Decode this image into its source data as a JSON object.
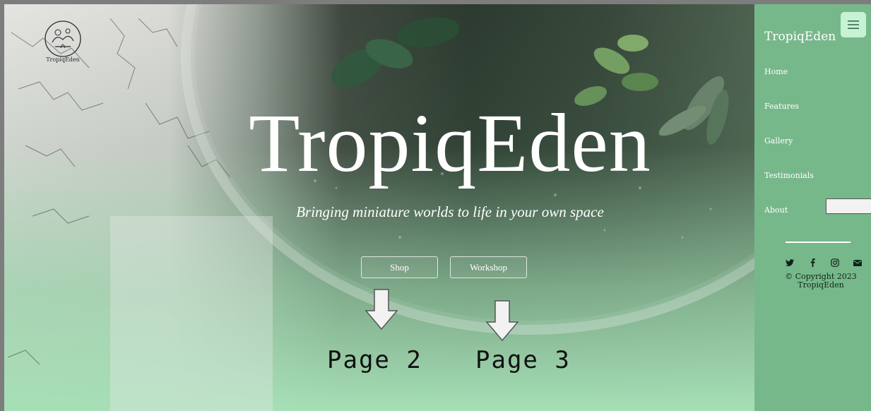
{
  "logo": {
    "text": "TropiqEden"
  },
  "hero": {
    "title": "TropiqEden",
    "subtitle": "Bringing miniature worlds to life in your own space",
    "buttons": {
      "shop": "Shop",
      "workshop": "Workshop"
    }
  },
  "annotations": {
    "page_2": "Page 2",
    "page_3": "Page 3"
  },
  "sidebar": {
    "brand": "TropiqEden",
    "menu_icon": "hamburger-icon",
    "nav": {
      "home": "Home",
      "features": "Features",
      "gallery": "Gallery",
      "testimonials": "Testimonials",
      "about": "About"
    },
    "about_input_value": "",
    "socials": [
      "twitter-icon",
      "facebook-icon",
      "instagram-icon",
      "email-icon"
    ],
    "copyright_line1": "© Copyright 2023",
    "copyright_line2": "TropiqEden"
  },
  "colors": {
    "sidebar_bg": "#77b88b",
    "menu_toggle_bg": "#c8f2d4",
    "hero_bottom": "#a6dfb6",
    "text_white": "#ffffff"
  }
}
